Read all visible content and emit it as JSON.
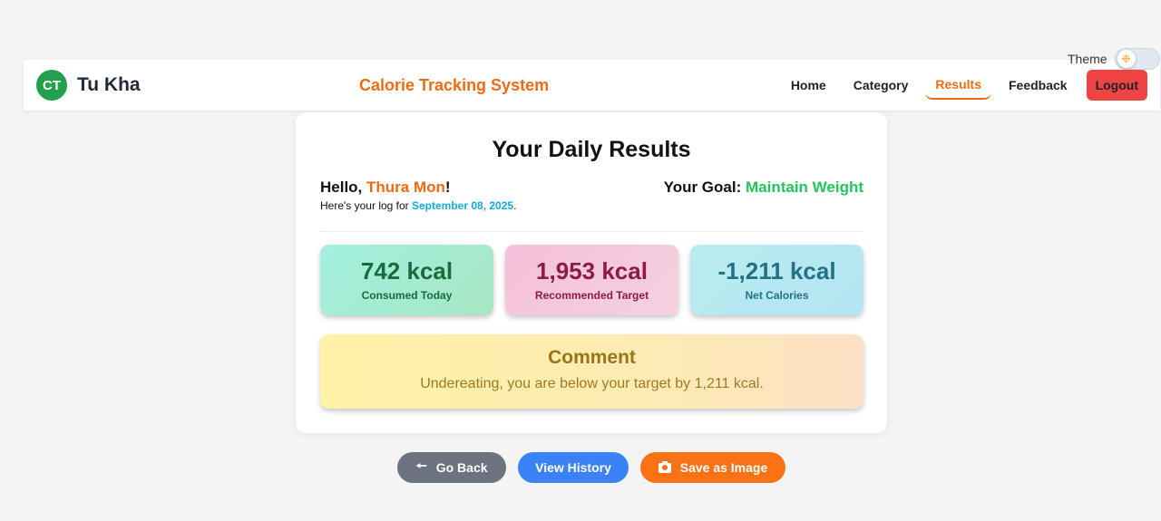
{
  "theme": {
    "label": "Theme",
    "icon": "sun-icon",
    "state": "light"
  },
  "navbar": {
    "logo_initials": "CT",
    "brand_name": "Tu Kha",
    "system_title": "Calorie Tracking System",
    "links": [
      {
        "label": "Home",
        "active": false
      },
      {
        "label": "Category",
        "active": false
      },
      {
        "label": "Results",
        "active": true
      },
      {
        "label": "Feedback",
        "active": false
      }
    ],
    "logout_label": "Logout"
  },
  "results": {
    "title": "Your Daily Results",
    "greeting_prefix": "Hello, ",
    "user_name": "Thura Mon",
    "greeting_suffix": "!",
    "log_prefix": "Here's your log for ",
    "log_date": "September 08, 2025",
    "log_suffix": ".",
    "goal_label": "Your Goal: ",
    "goal_value": "Maintain Weight",
    "stats": [
      {
        "value": "742 kcal",
        "label": "Consumed Today"
      },
      {
        "value": "1,953 kcal",
        "label": "Recommended Target"
      },
      {
        "value": "-1,211 kcal",
        "label": "Net Calories"
      }
    ],
    "comment": {
      "title": "Comment",
      "text": "Undereating, you are below your target by 1,211 kcal."
    }
  },
  "actions": {
    "back_label": "Go Back",
    "history_label": "View History",
    "save_label": "Save as Image"
  },
  "colors": {
    "brand_green": "#22a04b",
    "accent_orange": "#f06a13",
    "logout_red": "#ef4444",
    "date_blue": "#16a9d9",
    "goal_green": "#22c55e",
    "back_gray": "#6b7280",
    "history_blue": "#3b82f6",
    "save_orange": "#f97316"
  }
}
